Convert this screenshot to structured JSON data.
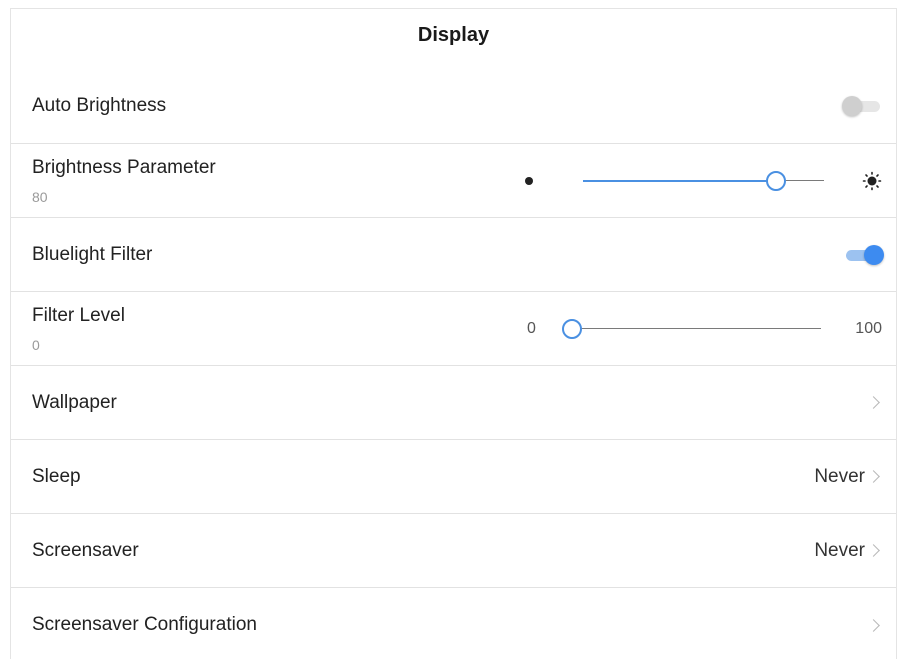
{
  "header": {
    "title": "Display"
  },
  "auto_brightness": {
    "label": "Auto Brightness",
    "enabled": false
  },
  "brightness": {
    "label": "Brightness Parameter",
    "value": "80",
    "percent": 80
  },
  "bluelight": {
    "label": "Bluelight Filter",
    "enabled": true
  },
  "filter_level": {
    "label": "Filter Level",
    "value": "0",
    "min_label": "0",
    "max_label": "100",
    "percent": 0
  },
  "wallpaper": {
    "label": "Wallpaper"
  },
  "sleep": {
    "label": "Sleep",
    "value": "Never"
  },
  "screensaver": {
    "label": "Screensaver",
    "value": "Never"
  },
  "screensaver_config": {
    "label": "Screensaver Configuration"
  },
  "colors": {
    "accent": "#4a90e2",
    "toggle_off_track": "#e6e6e6",
    "toggle_off_knob": "#cfcfcf",
    "toggle_on_track": "#9cc2f0",
    "toggle_on_knob": "#3d8bf0"
  },
  "icons": {
    "brightness_low": "dot-icon",
    "brightness_high": "sun-icon",
    "chevron": "chevron-right-icon"
  }
}
